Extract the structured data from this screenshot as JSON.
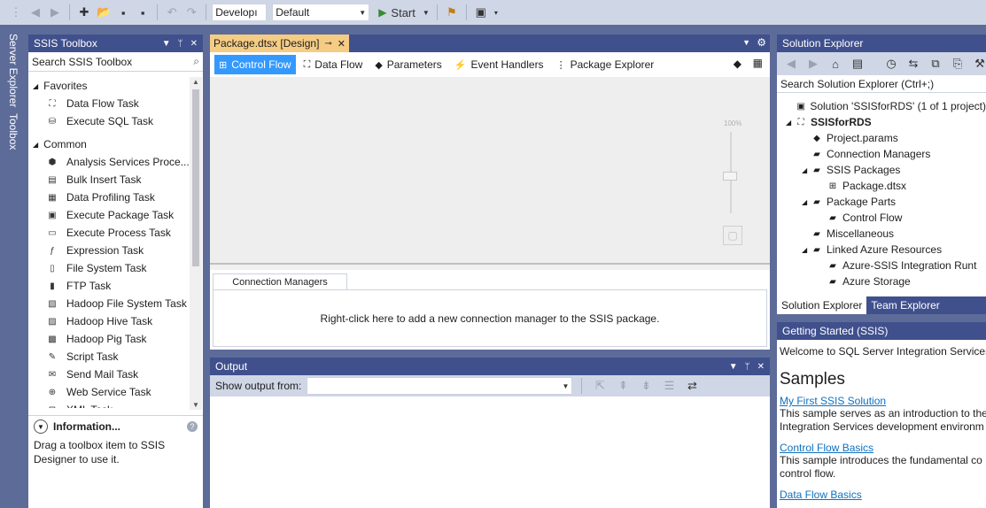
{
  "toolbar": {
    "config_combo": "Developı",
    "platform_combo": "Default",
    "start_label": "Start"
  },
  "side_tabs": {
    "server_explorer": "Server Explorer",
    "toolbox": "Toolbox"
  },
  "toolbox": {
    "title": "SSIS Toolbox",
    "search_placeholder": "Search SSIS Toolbox",
    "favorites_label": "Favorites",
    "favorites": [
      {
        "label": "Data Flow Task",
        "icon": "data-flow-task-icon"
      },
      {
        "label": "Execute SQL Task",
        "icon": "execute-sql-icon"
      }
    ],
    "common_label": "Common",
    "common": [
      {
        "label": "Analysis Services Proce...",
        "icon": "analysis-services-icon"
      },
      {
        "label": "Bulk Insert Task",
        "icon": "bulk-insert-icon"
      },
      {
        "label": "Data Profiling Task",
        "icon": "data-profiling-icon"
      },
      {
        "label": "Execute Package Task",
        "icon": "execute-package-icon"
      },
      {
        "label": "Execute Process Task",
        "icon": "execute-process-icon"
      },
      {
        "label": "Expression Task",
        "icon": "expression-icon"
      },
      {
        "label": "File System Task",
        "icon": "file-system-icon"
      },
      {
        "label": "FTP Task",
        "icon": "ftp-icon"
      },
      {
        "label": "Hadoop File System Task",
        "icon": "hadoop-fs-icon"
      },
      {
        "label": "Hadoop Hive Task",
        "icon": "hadoop-hive-icon"
      },
      {
        "label": "Hadoop Pig Task",
        "icon": "hadoop-pig-icon"
      },
      {
        "label": "Script Task",
        "icon": "script-icon"
      },
      {
        "label": "Send Mail Task",
        "icon": "send-mail-icon"
      },
      {
        "label": "Web Service Task",
        "icon": "web-service-icon"
      },
      {
        "label": "XML Task",
        "icon": "xml-icon"
      }
    ],
    "info_title": "Information...",
    "info_text": "Drag a toolbox item to SSIS Designer to use it."
  },
  "document": {
    "tab_title": "Package.dtsx [Design]",
    "designer_tabs": [
      {
        "label": "Control Flow",
        "icon": "control-flow-icon",
        "active": true
      },
      {
        "label": "Data Flow",
        "icon": "data-flow-icon",
        "active": false
      },
      {
        "label": "Parameters",
        "icon": "parameters-icon",
        "active": false
      },
      {
        "label": "Event Handlers",
        "icon": "event-handlers-icon",
        "active": false
      },
      {
        "label": "Package Explorer",
        "icon": "package-explorer-icon",
        "active": false
      }
    ],
    "zoom_label": "100%",
    "conn_tab": "Connection Managers",
    "conn_hint": "Right-click here to add a new connection manager to the SSIS package."
  },
  "output": {
    "title": "Output",
    "show_from_label": "Show output from:",
    "show_from_value": ""
  },
  "solution_explorer": {
    "title": "Solution Explorer",
    "search_placeholder": "Search Solution Explorer (Ctrl+;)",
    "tree": [
      {
        "label": "Solution 'SSISforRDS' (1 of 1 project)",
        "depth": 0,
        "expanded": null,
        "bold": false,
        "icon": "solution-icon"
      },
      {
        "label": "SSISforRDS",
        "depth": 0,
        "expanded": true,
        "bold": true,
        "icon": "project-icon"
      },
      {
        "label": "Project.params",
        "depth": 1,
        "expanded": null,
        "bold": false,
        "icon": "params-icon"
      },
      {
        "label": "Connection Managers",
        "depth": 1,
        "expanded": null,
        "bold": false,
        "icon": "folder-icon"
      },
      {
        "label": "SSIS Packages",
        "depth": 1,
        "expanded": true,
        "bold": false,
        "icon": "folder-icon"
      },
      {
        "label": "Package.dtsx",
        "depth": 2,
        "expanded": null,
        "bold": false,
        "icon": "package-icon"
      },
      {
        "label": "Package Parts",
        "depth": 1,
        "expanded": true,
        "bold": false,
        "icon": "folder-icon"
      },
      {
        "label": "Control Flow",
        "depth": 2,
        "expanded": null,
        "bold": false,
        "icon": "folder-icon"
      },
      {
        "label": "Miscellaneous",
        "depth": 1,
        "expanded": null,
        "bold": false,
        "icon": "folder-icon"
      },
      {
        "label": "Linked Azure Resources",
        "depth": 1,
        "expanded": true,
        "bold": false,
        "icon": "folder-icon"
      },
      {
        "label": "Azure-SSIS Integration Runt",
        "depth": 2,
        "expanded": null,
        "bold": false,
        "icon": "folder-icon"
      },
      {
        "label": "Azure Storage",
        "depth": 2,
        "expanded": null,
        "bold": false,
        "icon": "folder-icon"
      }
    ],
    "bottom_tabs": [
      "Solution Explorer",
      "Team Explorer"
    ]
  },
  "getting_started": {
    "title": "Getting Started (SSIS)",
    "welcome": "Welcome to SQL Server Integration Services",
    "samples_heading": "Samples",
    "samples": [
      {
        "link": "My First SSIS Solution",
        "desc": "This sample serves as an introduction to the Integration Services development environm"
      },
      {
        "link": "Control Flow Basics",
        "desc": "This sample introduces the fundamental co control flow."
      },
      {
        "link": "Data Flow Basics",
        "desc": ""
      }
    ]
  },
  "colors": {
    "accent_blue": "#3399ff",
    "panel_header": "#40508d",
    "doc_tab": "#f5cc84",
    "chrome": "#cfd6e5",
    "link": "#0e70c0"
  }
}
